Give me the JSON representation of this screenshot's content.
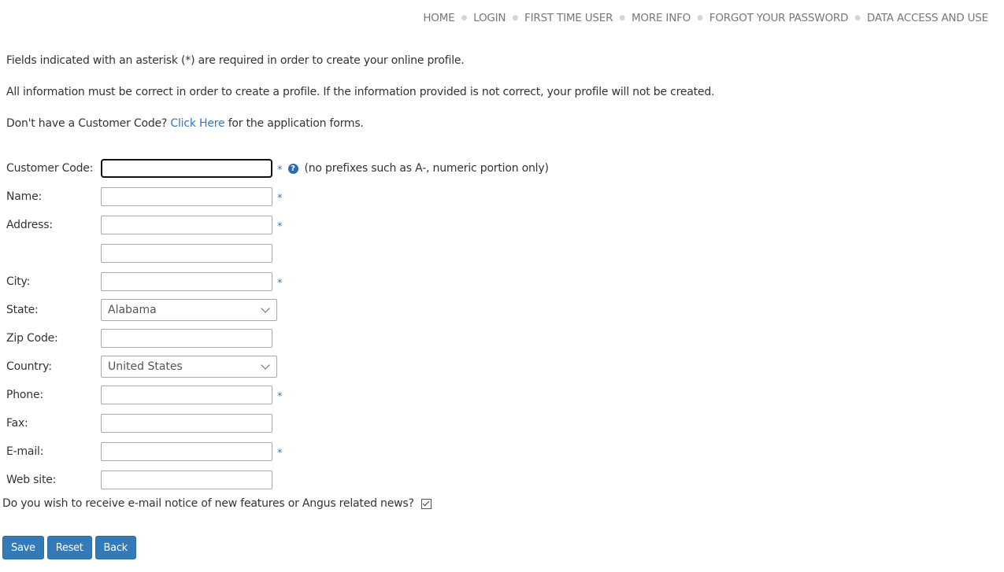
{
  "nav": {
    "items": [
      "HOME",
      "LOGIN",
      "FIRST TIME USER",
      "MORE INFO",
      "FORGOT YOUR PASSWORD",
      "DATA ACCESS AND USE"
    ],
    "separator": "●"
  },
  "intro": {
    "line1": "Fields indicated with an asterisk (*) are required in order to create your online profile.",
    "line2": "All information must be correct in order to create a profile. If the information provided is not correct, your profile will not be created.",
    "line3_pre": "Don't have a Customer Code? ",
    "line3_link": "Click Here",
    "line3_post": " for the application forms."
  },
  "form": {
    "customer_code": {
      "label": "Customer Code:",
      "value": "",
      "required": "*",
      "help_icon": "?",
      "hint": "(no prefixes such as A-, numeric portion only)"
    },
    "name": {
      "label": "Name:",
      "value": "",
      "required": "*"
    },
    "address": {
      "label": "Address:",
      "value": "",
      "required": "*"
    },
    "address2": {
      "value": ""
    },
    "city": {
      "label": "City:",
      "value": "",
      "required": "*"
    },
    "state": {
      "label": "State:",
      "selected": "Alabama"
    },
    "zip": {
      "label": "Zip Code:",
      "value": ""
    },
    "country": {
      "label": "Country:",
      "selected": "United States"
    },
    "phone": {
      "label": "Phone:",
      "value": "",
      "required": "*"
    },
    "fax": {
      "label": "Fax:",
      "value": ""
    },
    "email": {
      "label": "E-mail:",
      "value": "",
      "required": "*"
    },
    "website": {
      "label": "Web site:",
      "value": ""
    }
  },
  "newsletter": {
    "label": "Do you wish to receive e-mail notice of new features or Angus related news?",
    "checked": true
  },
  "buttons": {
    "save": "Save",
    "reset": "Reset",
    "back": "Back"
  }
}
